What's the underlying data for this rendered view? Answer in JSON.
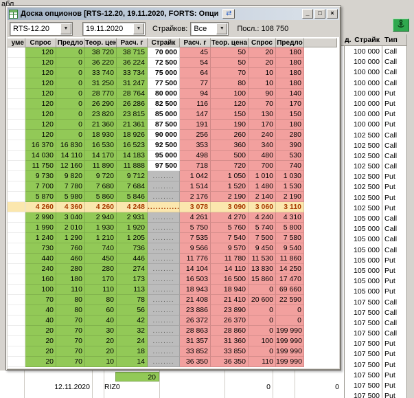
{
  "icons": {
    "dropdown": "▼",
    "swap": "⇄",
    "minimize": "_",
    "maximize": "□",
    "close": "×"
  },
  "background": {
    "top_left_fragment": "абл",
    "right_table": {
      "header_fragment": "д.",
      "headers": {
        "strike": "Страйк",
        "type": "Тип"
      },
      "rows": [
        [
          "100 000",
          "Call"
        ],
        [
          "100 000",
          "Call"
        ],
        [
          "100 000",
          "Call"
        ],
        [
          "100 000",
          "Call"
        ],
        [
          "100 000",
          "Put"
        ],
        [
          "100 000",
          "Put"
        ],
        [
          "100 000",
          "Put"
        ],
        [
          "100 000",
          "Put"
        ],
        [
          "102 500",
          "Call"
        ],
        [
          "102 500",
          "Call"
        ],
        [
          "102 500",
          "Call"
        ],
        [
          "102 500",
          "Call"
        ],
        [
          "102 500",
          "Put"
        ],
        [
          "102 500",
          "Put"
        ],
        [
          "102 500",
          "Put"
        ],
        [
          "102 500",
          "Put"
        ],
        [
          "105 000",
          "Call"
        ],
        [
          "105 000",
          "Call"
        ],
        [
          "105 000",
          "Call"
        ],
        [
          "105 000",
          "Call"
        ],
        [
          "105 000",
          "Put"
        ],
        [
          "105 000",
          "Put"
        ],
        [
          "105 000",
          "Put"
        ],
        [
          "105 000",
          "Put"
        ],
        [
          "107 500",
          "Call"
        ],
        [
          "107 500",
          "Call"
        ],
        [
          "107 500",
          "Call"
        ],
        [
          "107 500",
          "Call"
        ],
        [
          "107 500",
          "Put"
        ],
        [
          "107 500",
          "Put"
        ],
        [
          "107 500",
          "Put"
        ],
        [
          "107 500",
          "Put"
        ],
        [
          "107 500",
          "Put"
        ],
        [
          "107 500",
          "Put"
        ]
      ]
    },
    "bottom": {
      "partial_value": "20",
      "date": "12.11.2020",
      "code": "RIZ0",
      "zero1": "0",
      "zero2": "0"
    }
  },
  "dialog": {
    "title": "Доска опционов [RTS-12.20, 19.11.2020, FORTS: Опци",
    "toolbar": {
      "instrument": "RTS-12.20",
      "date": "19.11.2020",
      "strikes_label": "Страйков:",
      "strikes_value": "Все",
      "last_label": "Посл.:",
      "last_value": "108 750"
    },
    "table": {
      "headers": [
        "уме",
        "Спрос",
        "Предло",
        "Теор. цена",
        "Расч. г",
        "Страйк",
        "Расч. г",
        "Теор. цена",
        "Спрос",
        "Предло"
      ],
      "highlight_index": 15,
      "rows": [
        [
          "120",
          "0",
          "38 720",
          "38 715",
          "70 000",
          "45",
          "50",
          "20",
          "180"
        ],
        [
          "120",
          "0",
          "36 220",
          "36 224",
          "72 500",
          "54",
          "50",
          "20",
          "180"
        ],
        [
          "120",
          "0",
          "33 740",
          "33 734",
          "75 000",
          "64",
          "70",
          "10",
          "180"
        ],
        [
          "120",
          "0",
          "31 250",
          "31 247",
          "77 500",
          "77",
          "80",
          "10",
          "180"
        ],
        [
          "120",
          "0",
          "28 770",
          "28 764",
          "80 000",
          "94",
          "100",
          "90",
          "140"
        ],
        [
          "120",
          "0",
          "26 290",
          "26 286",
          "82 500",
          "116",
          "120",
          "70",
          "170"
        ],
        [
          "120",
          "0",
          "23 820",
          "23 815",
          "85 000",
          "147",
          "150",
          "130",
          "150"
        ],
        [
          "120",
          "0",
          "21 360",
          "21 361",
          "87 500",
          "191",
          "190",
          "170",
          "180"
        ],
        [
          "120",
          "0",
          "18 930",
          "18 926",
          "90 000",
          "256",
          "260",
          "240",
          "280"
        ],
        [
          "16 370",
          "16 830",
          "16 530",
          "16 523",
          "92 500",
          "353",
          "360",
          "340",
          "390"
        ],
        [
          "14 030",
          "14 110",
          "14 170",
          "14 183",
          "95 000",
          "498",
          "500",
          "480",
          "530"
        ],
        [
          "11 750",
          "12 160",
          "11 890",
          "11 888",
          "97 500",
          "718",
          "720",
          "700",
          "740"
        ],
        [
          "9 730",
          "9 820",
          "9 720",
          "9 712",
          "........",
          "1 042",
          "1 050",
          "1 010",
          "1 030"
        ],
        [
          "7 700",
          "7 780",
          "7 680",
          "7 684",
          "........",
          "1 514",
          "1 520",
          "1 480",
          "1 530"
        ],
        [
          "5 870",
          "5 980",
          "5 860",
          "5 846",
          "........",
          "2 176",
          "2 190",
          "2 140",
          "2 190"
        ],
        [
          "4 260",
          "4 360",
          "4 260",
          "4 248",
          "............",
          "3 078",
          "3 090",
          "3 060",
          "3 110"
        ],
        [
          "2 990",
          "3 040",
          "2 940",
          "2 931",
          "........",
          "4 261",
          "4 270",
          "4 240",
          "4 310"
        ],
        [
          "1 990",
          "2 010",
          "1 930",
          "1 920",
          "........",
          "5 750",
          "5 760",
          "5 740",
          "5 800"
        ],
        [
          "1 240",
          "1 290",
          "1 210",
          "1 205",
          "........",
          "7 535",
          "7 540",
          "7 500",
          "7 580"
        ],
        [
          "730",
          "760",
          "740",
          "736",
          "........",
          "9 566",
          "9 570",
          "9 450",
          "9 540"
        ],
        [
          "440",
          "460",
          "450",
          "446",
          "........",
          "11 776",
          "11 780",
          "11 530",
          "11 860"
        ],
        [
          "240",
          "280",
          "280",
          "274",
          "........",
          "14 104",
          "14 110",
          "13 830",
          "14 250"
        ],
        [
          "160",
          "180",
          "170",
          "173",
          "........",
          "16 503",
          "16 500",
          "15 860",
          "17 470"
        ],
        [
          "100",
          "110",
          "110",
          "113",
          "........",
          "18 943",
          "18 940",
          "0",
          "69 660"
        ],
        [
          "70",
          "80",
          "80",
          "78",
          "........",
          "21 408",
          "21 410",
          "20 600",
          "22 590"
        ],
        [
          "40",
          "80",
          "60",
          "56",
          "........",
          "23 886",
          "23 890",
          "0",
          "0"
        ],
        [
          "40",
          "70",
          "40",
          "42",
          "........",
          "26 372",
          "26 370",
          "0",
          "0"
        ],
        [
          "20",
          "70",
          "30",
          "32",
          "........",
          "28 863",
          "28 860",
          "0",
          "199 990"
        ],
        [
          "20",
          "70",
          "20",
          "24",
          "........",
          "31 357",
          "31 360",
          "100",
          "199 990"
        ],
        [
          "20",
          "70",
          "20",
          "18",
          "........",
          "33 852",
          "33 850",
          "0",
          "199 990"
        ],
        [
          "20",
          "70",
          "10",
          "14",
          "........",
          "36 350",
          "36 350",
          "110",
          "199 990"
        ]
      ]
    }
  }
}
